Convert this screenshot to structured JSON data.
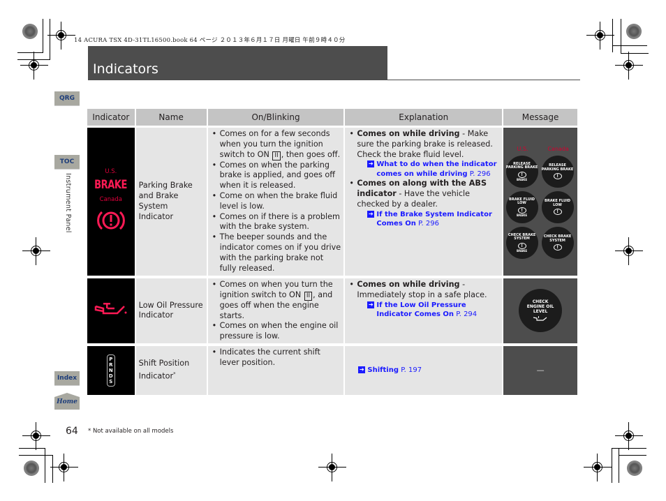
{
  "print_header": "14 ACURA TSX 4D-31TL16500.book  64 ページ  ２０１３年６月１７日  月曜日  午前９時４０分",
  "page_title": "Indicators",
  "nav": {
    "qrg": "QRG",
    "toc": "TOC",
    "index": "Index",
    "home": "Home"
  },
  "section_label": "Instrument Panel",
  "table": {
    "headers": [
      "Indicator",
      "Name",
      "On/Blinking",
      "Explanation",
      "Message"
    ],
    "rows": [
      {
        "indicator": {
          "us_label": "U.S.",
          "us_text": "BRAKE",
          "canada_label": "Canada",
          "icon": "brake-warning-icon"
        },
        "name": "Parking Brake and Brake System Indicator",
        "on_blinking": [
          "Comes on for a few seconds when you turn the ignition switch to ON",
          "II",
          ", then goes off.",
          "Comes on when the parking brake is applied, and goes off when it is released.",
          "Come on when the brake fluid level is low.",
          "Comes on if there is a problem with the brake system.",
          "The beeper sounds and the indicator comes on if you drive with the parking brake not fully released."
        ],
        "explanation": [
          {
            "bold": "Comes on while driving",
            "text": " - Make sure the parking brake is released. Check the brake fluid level.",
            "xref_bold": "What to do when the indicator comes on while driving",
            "xref_page": "P. 296"
          },
          {
            "bold": "Comes on along with the ABS indicator",
            "text": " - Have the vehicle checked by a dealer.",
            "xref_bold": "If the Brake System Indicator Comes On",
            "xref_page": "P. 296"
          }
        ],
        "message": {
          "us_label": "U.S.",
          "canada_label": "Canada",
          "us": [
            "RELEASE PARKING BRAKE",
            "BRAKE FLUID LOW",
            "CHECK BRAKE SYSTEM"
          ],
          "canada": [
            "RELEASE PARKING BRAKE",
            "BRAKE FLUID LOW",
            "CHECK BRAKE SYSTEM"
          ],
          "us_sub": "BRAKE"
        }
      },
      {
        "indicator": {
          "icon": "oil-can-icon"
        },
        "name": "Low Oil Pressure Indicator",
        "on_blinking": [
          "Comes on when you turn the ignition switch to ON",
          "II",
          ", and goes off when the engine starts.",
          "Comes on when the engine oil pressure is low."
        ],
        "explanation": [
          {
            "bold": "Comes on while driving",
            "text": " - Immediately stop in a safe place.",
            "xref_bold": "If the Low Oil Pressure Indicator Comes On",
            "xref_page": "P. 294"
          }
        ],
        "message": {
          "text": "CHECK ENGINE OIL LEVEL"
        }
      },
      {
        "indicator": {
          "letters": [
            "P",
            "R",
            "N",
            "D",
            "S"
          ]
        },
        "name": "Shift Position Indicator",
        "name_mark": "*",
        "on_blinking": [
          "Indicates the current shift lever position."
        ],
        "explanation": [
          {
            "xref_bold": "Shifting",
            "xref_page": "P. 197"
          }
        ],
        "message": {
          "text": "—"
        }
      }
    ]
  },
  "page_number": "64",
  "footnote": "* Not available on all models",
  "colors": {
    "title_bar": "#4d4d4d",
    "cell_bg": "#e5e5e5",
    "header_bg": "#c4c4c4",
    "indicator_red": "#ff1a55",
    "link_blue": "#1a1aff",
    "nav_button": "#a8a8a0"
  }
}
